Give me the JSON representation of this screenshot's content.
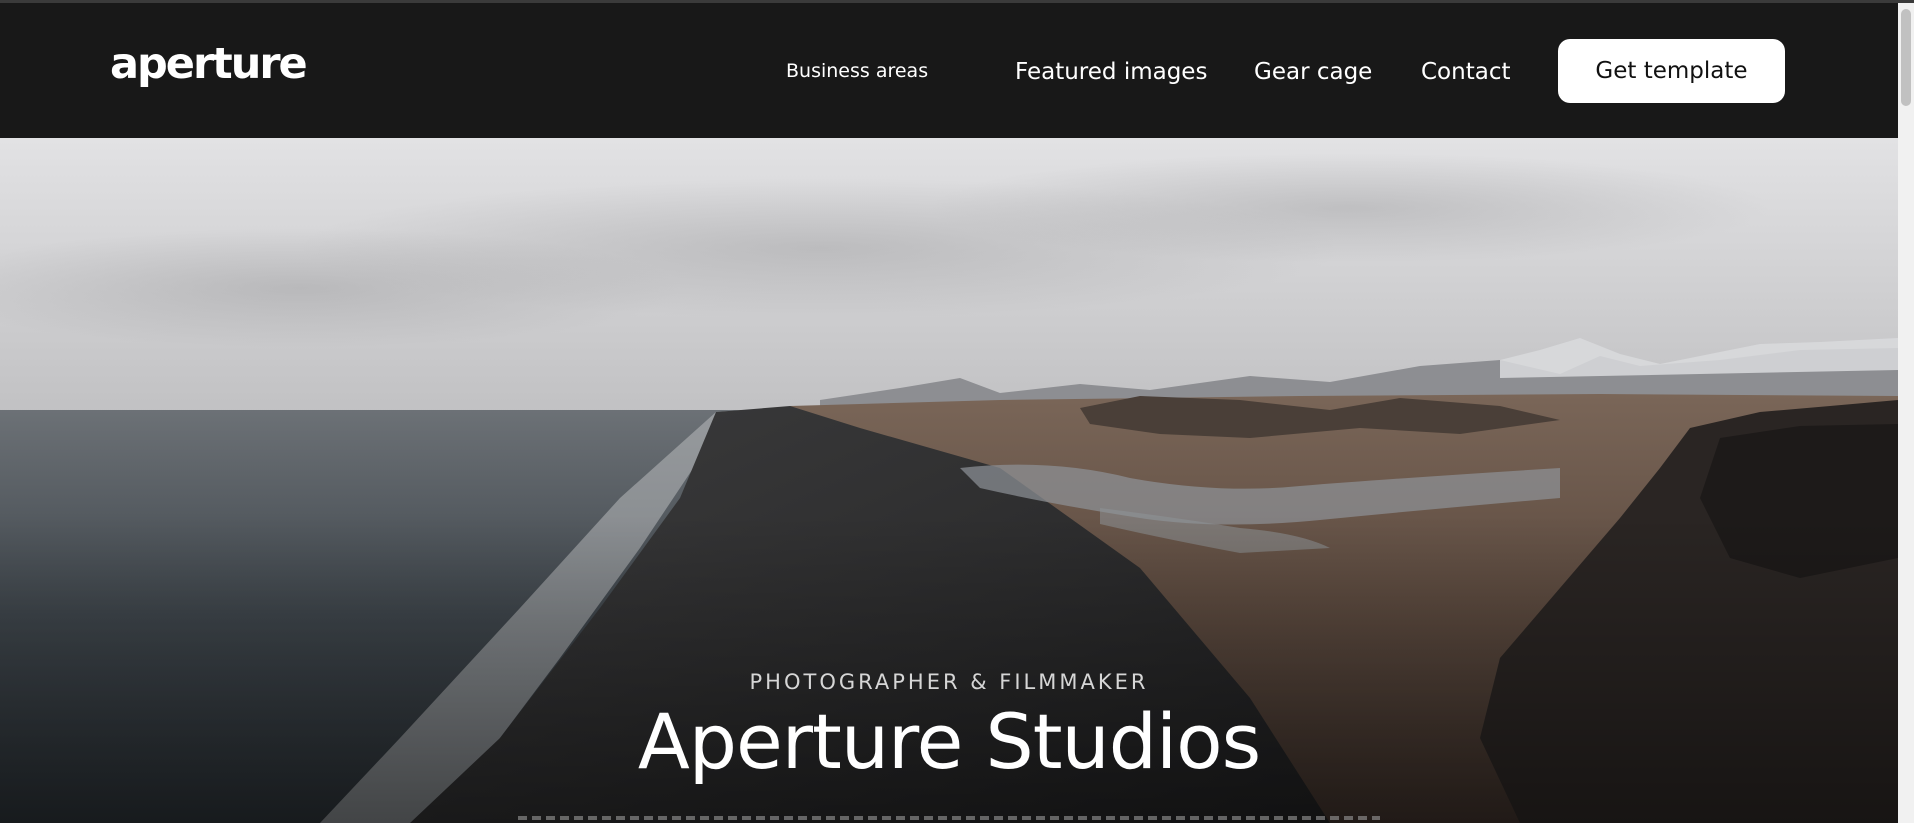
{
  "header": {
    "logo": "aperture",
    "nav": {
      "business_areas": "Business areas",
      "featured_images": "Featured images",
      "gear_cage": "Gear cage",
      "contact": "Contact"
    },
    "cta_label": "Get template"
  },
  "hero": {
    "eyebrow": "PHOTOGRAPHER & FILMMAKER",
    "title": "Aperture Studios",
    "background": "coastal-landscape-photo"
  },
  "colors": {
    "header_bg": "#181818",
    "cta_bg": "#ffffff",
    "cta_text": "#111111",
    "text_light": "#ffffff"
  }
}
